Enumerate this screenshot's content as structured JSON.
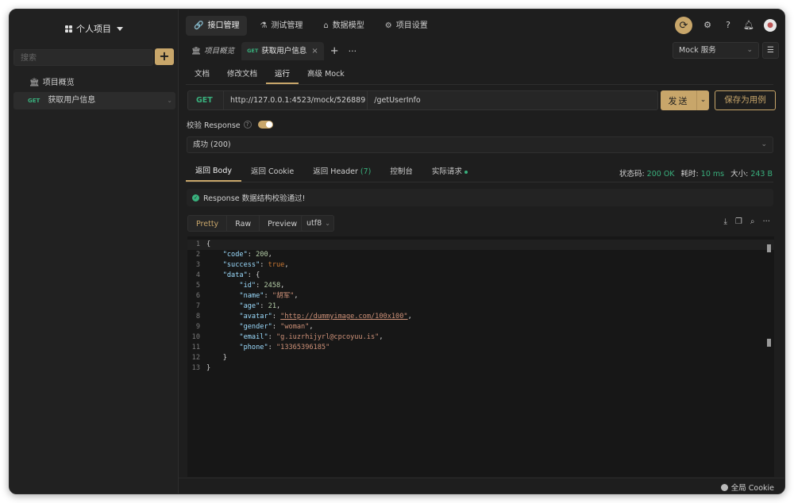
{
  "sidebar": {
    "project_title": "个人项目",
    "search_placeholder": "搜索",
    "add_label": "+",
    "items": [
      {
        "label": "项目概览"
      },
      {
        "method": "GET",
        "label": "获取用户信息"
      }
    ]
  },
  "topnav": {
    "items": [
      {
        "label": "接口管理",
        "icon": "link-icon"
      },
      {
        "label": "测试管理",
        "icon": "flask-icon"
      },
      {
        "label": "数据模型",
        "icon": "model-icon"
      },
      {
        "label": "项目设置",
        "icon": "gear-icon"
      }
    ]
  },
  "tabs": {
    "items": [
      {
        "label": "项目概览"
      },
      {
        "method": "GET",
        "label": "获取用户信息"
      }
    ],
    "plus": "+",
    "more": "···"
  },
  "mock_select": {
    "value": "Mock 服务"
  },
  "subtabs": [
    "文档",
    "修改文档",
    "运行",
    "高级 Mock"
  ],
  "request": {
    "method": "GET",
    "base_url": "http://127.0.0.1:4523/mock/526889",
    "path": "/getUserInfo",
    "send_label": "发送",
    "save_label": "保存为用例"
  },
  "validate": {
    "label": "校验 Response"
  },
  "status_select": {
    "value": "成功 (200)"
  },
  "response_tabs": [
    {
      "label": "返回 Body"
    },
    {
      "label": "返回 Cookie"
    },
    {
      "label": "返回 Header",
      "count": "(7)"
    },
    {
      "label": "控制台"
    },
    {
      "label": "实际请求"
    }
  ],
  "response_meta": {
    "status_label": "状态码:",
    "status_value": "200 OK",
    "time_label": "耗时:",
    "time_value": "10 ms",
    "size_label": "大小:",
    "size_value": "243 B"
  },
  "validation_message": "Response 数据结构校验通过!",
  "view_tabs": [
    "Pretty",
    "Raw",
    "Preview"
  ],
  "encoding": "utf8",
  "code": {
    "line_numbers": [
      "1",
      "2",
      "3",
      "4",
      "5",
      "6",
      "7",
      "8",
      "9",
      "10",
      "11",
      "12",
      "13"
    ],
    "code_value": "200",
    "success_value": "true",
    "id": "2458",
    "name": "\"胡军\"",
    "age": "21",
    "avatar": "\"http://dummyimage.com/100x100\"",
    "gender": "\"woman\"",
    "email": "\"g.iuzrhijyrl@cpcoyuu.is\"",
    "phone": "\"13365396185\""
  },
  "footer": {
    "global_cookie": "全局 Cookie"
  },
  "colors": {
    "accent": "#c8a66a",
    "success": "#39b07d",
    "background": "#1e1e1e"
  }
}
